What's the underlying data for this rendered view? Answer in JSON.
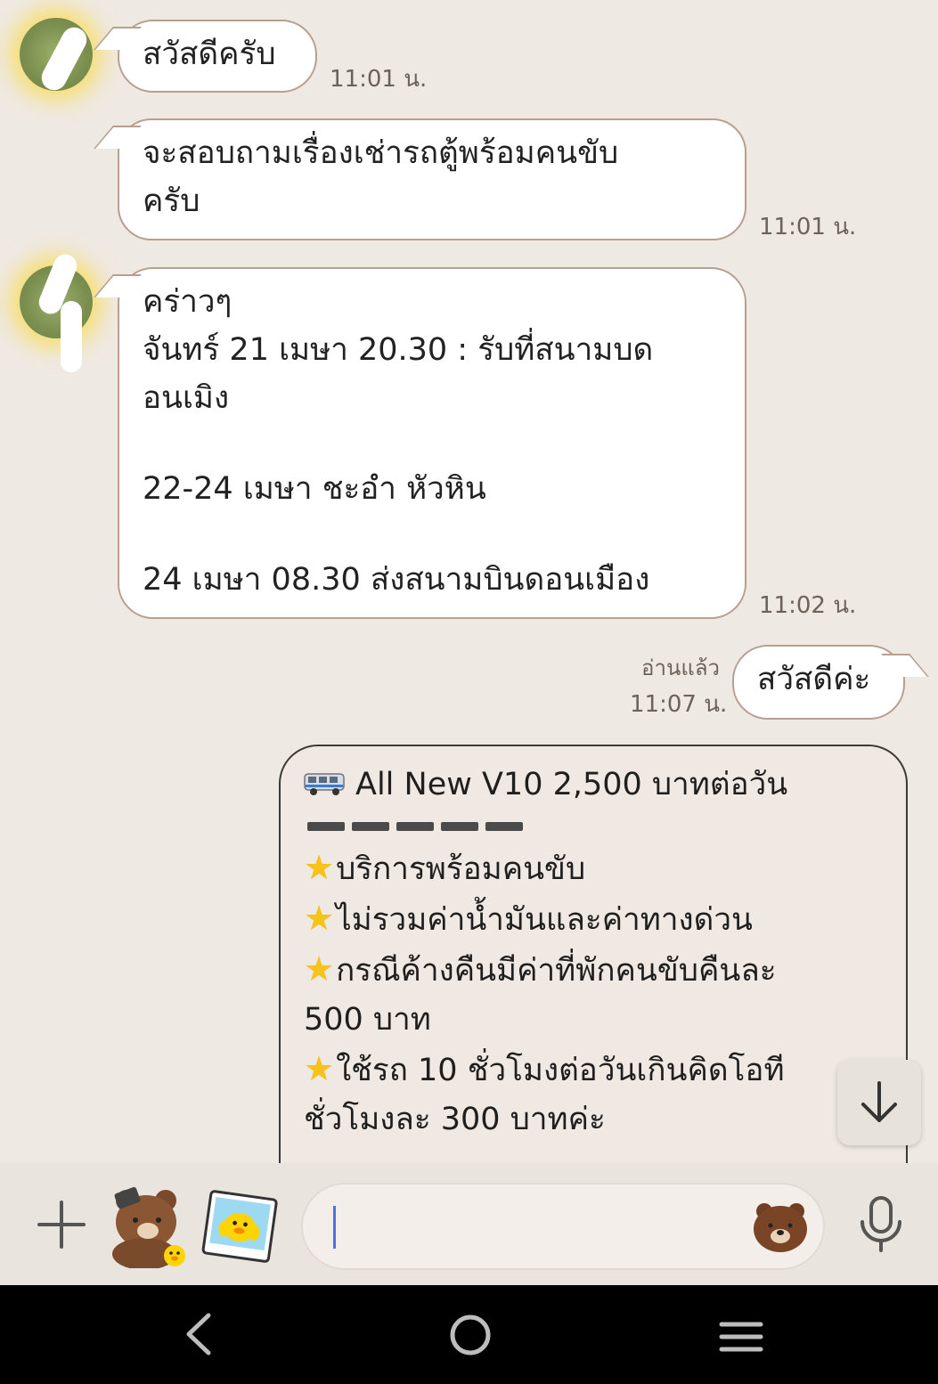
{
  "messages": [
    {
      "id": "m1",
      "direction": "in",
      "lines": [
        "สวัสดีครับ"
      ],
      "time": "11:01 น."
    },
    {
      "id": "m2",
      "direction": "in",
      "lines": [
        "จะสอบถามเรื่องเช่ารถตู้พร้อมคนขับ",
        "ครับ"
      ],
      "time": "11:01 น."
    },
    {
      "id": "m3",
      "direction": "in",
      "lines": [
        "คร่าวๆ",
        "จันทร์ 21 เมษา 20.30 : รับที่สนามบด",
        "อนเมิง",
        "",
        "22-24 เมษา ชะอำ หัวหิน",
        "",
        "24 เมษา 08.30 ส่งสนามบินดอนเมือง"
      ],
      "time": "11:02 น."
    },
    {
      "id": "m4",
      "direction": "out",
      "lines": [
        "สวัสดีค่ะ"
      ],
      "read": "อ่านแล้ว",
      "time": "11:07 น."
    }
  ],
  "card": {
    "title": "All New V10 2,500 บาทต่อวัน",
    "title_icon": "van-icon",
    "lines": [
      "บริการพร้อมคนขับ",
      "ไม่รวมค่าน้ำมันและค่าทางด่วน",
      "กรณีค้างคืนมีค่าที่พักคนขับคืนละ",
      "500 บาท",
      "ใช้รถ 10 ชั่วโมงต่อวันเกินคิดโอที",
      "ชั่วโมงละ 300 บาทค่ะ"
    ],
    "bullet_icon": "star-icon",
    "bullet_color": "#f7c21a"
  },
  "input_bar": {
    "text_value": "",
    "icons": [
      "plus-icon",
      "sticker-brown-icon",
      "sticker-sally-photo-icon",
      "emoji-bear-icon",
      "microphone-icon"
    ]
  },
  "scroll_down": {
    "icon": "arrow-down-icon"
  },
  "nav_bar": {
    "icons": [
      "back-icon",
      "home-icon",
      "recents-icon"
    ]
  },
  "colors": {
    "background": "#efe9e3",
    "bubble_border": "#b89f8f",
    "avatar_glow": "#ffd600",
    "caret": "#4a72e8"
  }
}
